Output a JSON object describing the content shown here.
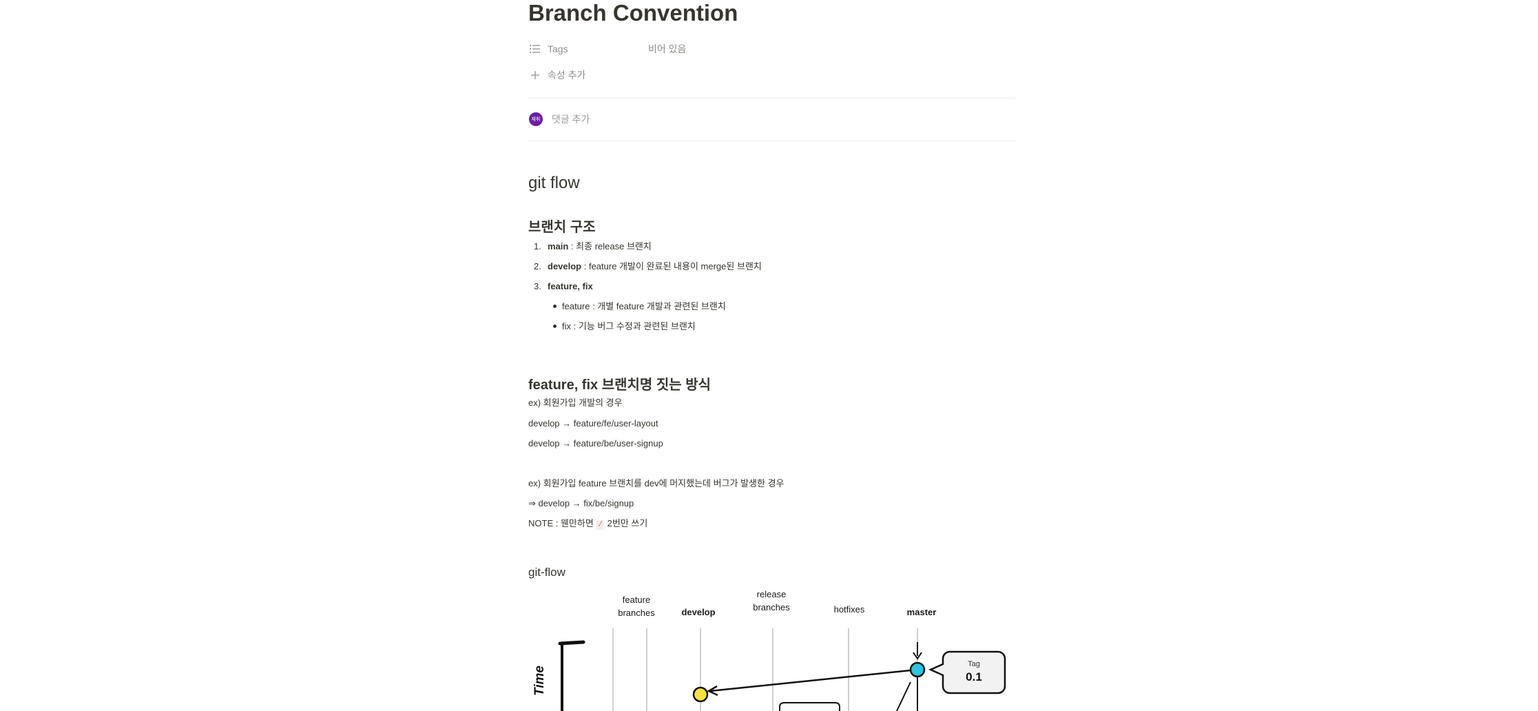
{
  "page": {
    "title": "Branch Convention",
    "properties": {
      "tags_label": "Tags",
      "tags_value": "비어 있음",
      "add_property": "속성 추가"
    },
    "comment": {
      "avatar_text": "재휘",
      "placeholder": "댓글 추가"
    }
  },
  "section_gitflow": {
    "heading": "git flow",
    "structure": {
      "heading": "브랜치 구조",
      "items": [
        {
          "num": "1.",
          "name": "main",
          "desc": " : 최종 release 브랜치"
        },
        {
          "num": "2.",
          "name": "develop",
          "desc": " : feature 개발이 완료된 내용이 merge된 브랜치"
        },
        {
          "num": "3.",
          "name": "feature, fix",
          "desc": ""
        }
      ],
      "subitems": [
        "feature : 개별 feature 개발과 관련된 브랜치",
        "fix : 기능 버그 수정과 관련된 브랜치"
      ]
    },
    "naming": {
      "heading": "feature, fix 브랜치명 짓는 방식",
      "lines": [
        "ex) 회원가입 개발의 경우",
        "develop → feature/fe/user-layout",
        "develop → feature/be/user-signup",
        "ex) 회원가입 feature 브랜치를 dev에 머지했는데 버그가 발생한 경우",
        "⇒ develop → fix/be/signup"
      ],
      "note_prefix": "NOTE : 웬만하면 ",
      "note_code": "/",
      "note_suffix": " 2번만 쓰기"
    },
    "diagram": {
      "heading": "git-flow",
      "columns": {
        "feature_line1": "feature",
        "feature_line2": "branches",
        "develop": "develop",
        "release_line1": "release",
        "release_line2": "branches",
        "hotfixes": "hotfixes",
        "master": "master"
      },
      "time_label": "Time",
      "tag_label": "Tag",
      "tag_value": "0.1",
      "colors": {
        "develop_node": "#f5e33a",
        "master_node": "#2ec3e0"
      }
    }
  }
}
